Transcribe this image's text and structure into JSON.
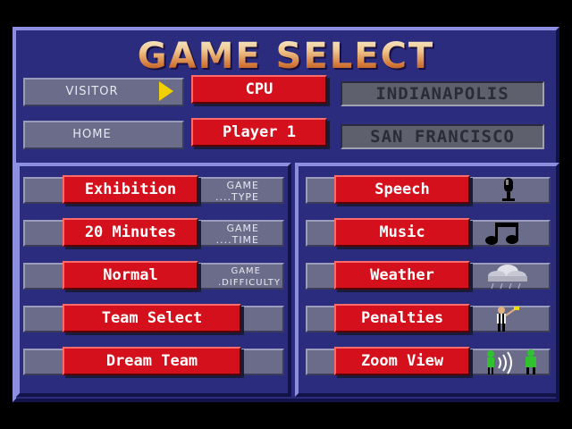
{
  "title": "GAME SELECT",
  "teams": {
    "visitor": {
      "label": "VISITOR",
      "controller": "CPU",
      "team": "INDIANAPOLIS"
    },
    "home": {
      "label": "HOME",
      "controller": "Player 1",
      "team": "SAN FRANCISCO"
    }
  },
  "left_options": [
    {
      "button": "Exhibition",
      "sub1": "GAME",
      "sub2": "....TYPE"
    },
    {
      "button": "20 Minutes",
      "sub1": "GAME",
      "sub2": "....TIME"
    },
    {
      "button": "Normal",
      "sub1": "GAME",
      "sub2": ".DIFFICULTY"
    },
    {
      "button": "Team Select"
    },
    {
      "button": "Dream Team"
    }
  ],
  "right_options": [
    {
      "button": "Speech",
      "icon": "microphone-icon"
    },
    {
      "button": "Music",
      "icon": "music-note-icon"
    },
    {
      "button": "Weather",
      "icon": "cloud-rain-icon"
    },
    {
      "button": "Penalties",
      "icon": "referee-icon"
    },
    {
      "button": "Zoom View",
      "icon": "zoom-view-icon"
    }
  ],
  "colors": {
    "frame": "#2b2c7e",
    "button": "#d4101c",
    "bar": "#6a6c8a",
    "arrow": "#f0d000"
  }
}
